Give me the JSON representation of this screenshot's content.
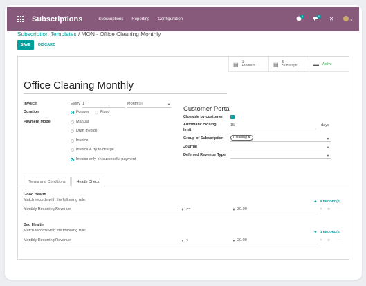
{
  "topbar": {
    "app_name": "Subscriptions",
    "menu": [
      "Subscriptions",
      "Reporting",
      "Configuration"
    ],
    "systray": {
      "activity_badge": "8",
      "messages_badge": "6",
      "close_symbol": "✕"
    },
    "colors": {
      "brand": "#875a7b",
      "accent": "#00a09d"
    }
  },
  "breadcrumb": {
    "parent": "Subscription Templates",
    "separator": "/",
    "current": "MON - Office Cleaning Monthly"
  },
  "buttons": {
    "save": "SAVE",
    "discard": "DISCARD"
  },
  "stat_buttons": [
    {
      "icon": "book-icon",
      "count": "1",
      "label": "Products"
    },
    {
      "icon": "book-icon",
      "count": "5",
      "label": "Subscripti..."
    },
    {
      "icon": "archive-icon",
      "label": "Active"
    }
  ],
  "record": {
    "name": "Office Cleaning Monthly",
    "invoice_label": "Invoice",
    "invoice_every": "Every",
    "invoice_interval": "1",
    "invoice_unit": "Month(s)",
    "duration_label": "Duration",
    "duration_options": [
      "Forever",
      "Fixed"
    ],
    "duration_selected": "Forever",
    "payment_mode_label": "Payment Mode",
    "payment_mode_options": [
      "Manual",
      "Draft invoice",
      "Invoice",
      "Invoice & try to charge",
      "Invoice only on successful payment"
    ],
    "payment_mode_selected": "Invoice only on successful payment"
  },
  "portal": {
    "title": "Customer Portal",
    "closable_label": "Closable by customer",
    "closable_value": true,
    "auto_close_label_1": "Automatic closing",
    "auto_close_label_2": "limit",
    "auto_close_value": "15",
    "auto_close_unit": "days",
    "group_label": "Group of Subscription",
    "group_tag": "Cleaning ✕",
    "journal_label": "Journal",
    "deferred_label": "Deferred Revenue Type"
  },
  "tabs": [
    {
      "label": "Terms and Conditions",
      "active": false
    },
    {
      "label": "Health Check",
      "active": true
    }
  ],
  "health": {
    "good": {
      "title": "Good Health",
      "rule_text": "Match records with the following rule:",
      "records": "8 RECORD(S)",
      "field": "Monthly Recurring Revenue",
      "operator": ">=",
      "value": "20.00"
    },
    "bad": {
      "title": "Bad Health",
      "rule_text": "Match records with the following rule:",
      "records": "1 RECORD(S)",
      "field": "Monthly Recurring Revenue",
      "operator": "<",
      "value": "20.00"
    }
  }
}
